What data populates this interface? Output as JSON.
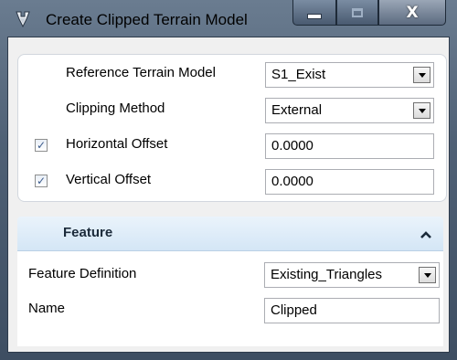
{
  "window": {
    "title": "Create Clipped Terrain Model",
    "buttons": {
      "minimize": "minimize",
      "maximize": "maximize",
      "close": "close"
    }
  },
  "form": {
    "reference_label": "Reference Terrain Model",
    "reference_value": "S1_Exist",
    "clipping_label": "Clipping Method",
    "clipping_value": "External",
    "horizontal_label": "Horizontal Offset",
    "horizontal_checked": true,
    "horizontal_value": "0.0000",
    "vertical_label": "Vertical Offset",
    "vertical_checked": true,
    "vertical_value": "0.0000"
  },
  "feature": {
    "header": "Feature",
    "expanded": true,
    "definition_label": "Feature Definition",
    "definition_value": "Existing_Triangles",
    "name_label": "Name",
    "name_value": "Clipped"
  },
  "colors": {
    "titlebar": "#4f6075",
    "section_header": "#d4e6f6",
    "checkbox_mark": "#3a5a8c"
  }
}
